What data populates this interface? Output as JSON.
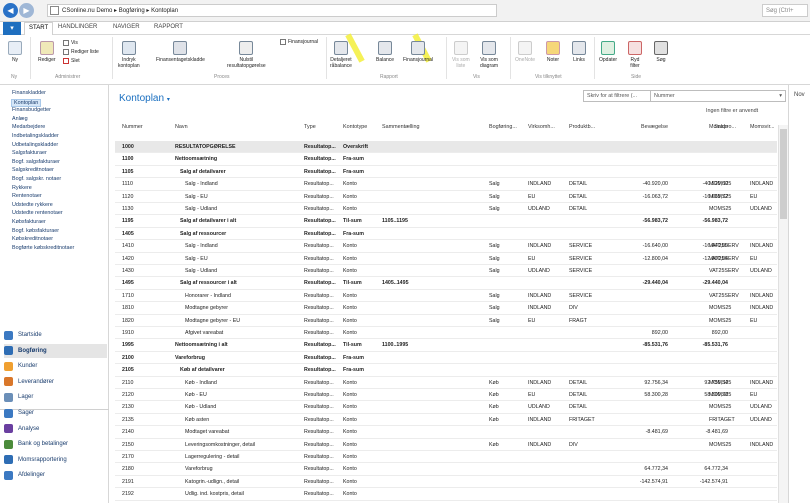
{
  "window": {
    "address": "CSonline.nu Demo  ▸  Bogføring  ▸  Kontoplan",
    "search_placeholder": "Søg (Ctrl+"
  },
  "tabs": [
    {
      "label": "START"
    },
    {
      "label": "HANDLINGER"
    },
    {
      "label": "NAVIGER"
    },
    {
      "label": "RAPPORT"
    }
  ],
  "ribbon": {
    "buttons": {
      "ny": "Ny",
      "rediger": "Rediger",
      "indryk": "Indryk\nkontoplan",
      "finanskladde": "Finansentagetskladde",
      "nulstil": "Nulstil\nresultatopgørelse",
      "detaljeret": "Detaljeret\nråbalance",
      "balance": "Balance",
      "finansjournal": "Finansjournal",
      "vis_som_liste": "Vis som\nliste",
      "vis_som_diagram": "Vis som\ndiagram",
      "onenote": "OneNote",
      "noter": "Noter",
      "links": "Links",
      "opdater": "Opdater",
      "ryd_filter": "Ryd\nfilter",
      "sog": "Søg"
    },
    "small": {
      "vis": "Vis",
      "rediger_liste": "Rediger liste",
      "slet": "Slet",
      "finansjournal2": "Finansjournal"
    },
    "groups": {
      "ny": "Ny",
      "administrer": "Administrer",
      "proces": "Proces",
      "rapport": "Rapport",
      "vis": "Vis",
      "vis_tilknyttet": "Vis tilknyttet",
      "side": "Side"
    }
  },
  "leftnav": {
    "links": [
      "Finanskladder",
      "Kontoplan",
      "Finansbudgetter",
      "Anlæg",
      "Medarbejdere",
      "Indbetalingskladder",
      "Udbetalingskladder",
      "Salgsfakturaer",
      "Bogf. salgsfakturaer",
      "Salgskreditnotaer",
      "Bogf. salgskr. notaer",
      "Rykkere",
      "Rentenotaer",
      "Udstedte rykkere",
      "Udstedte rentenotaer",
      "Købsfakturaer",
      "Bogf. købsfakturaer",
      "Købskreditnotaer",
      "Bogførte købskreditnotaer"
    ],
    "sections": [
      "Startside",
      "Bogføring",
      "Kunder",
      "Leverandører",
      "Lager",
      "Sager",
      "Analyse",
      "Bank og betalinger",
      "Momsrapportering",
      "Afdelinger"
    ]
  },
  "main": {
    "title": "Kontoplan",
    "filter_placeholder": "Skriv for at filtrere (...",
    "filter_field": "Nummer",
    "no_filter": "Ingen filtre er anvendt",
    "columns": [
      "Nummer",
      "Navn",
      "Type",
      "Kontotype",
      "Sammentælling",
      "Bogføring...",
      "Virksomh...",
      "Produktb...",
      "Bevægelse",
      "Saldo",
      "Momspro...",
      "Momsvir..."
    ],
    "rows": [
      [
        "1000",
        "RESULTATOPGØRELSE",
        "Resultatop...",
        "Overskrift",
        "",
        "",
        "",
        "",
        "",
        "",
        "",
        ""
      ],
      [
        "1100",
        "Nettoomsætning",
        "Resultatop...",
        "Fra-sum",
        "",
        "",
        "",
        "",
        "",
        "",
        "",
        ""
      ],
      [
        "1105",
        "Salg af detailvarer",
        "Resultatop...",
        "Fra-sum",
        "",
        "",
        "",
        "",
        "",
        "",
        "",
        ""
      ],
      [
        "1110",
        "Salg - Indland",
        "Resultatop...",
        "Konto",
        "",
        "Salg",
        "INDLAND",
        "DETAIL",
        "-40.920,00",
        "-40.920,00",
        "MOMS25",
        "INDLAND"
      ],
      [
        "1120",
        "Salg - EU",
        "Resultatop...",
        "Konto",
        "",
        "Salg",
        "EU",
        "DETAIL",
        "-16.063,72",
        "-16.063,72",
        "MOMS25",
        "EU"
      ],
      [
        "1130",
        "Salg - Udland",
        "Resultatop...",
        "Konto",
        "",
        "Salg",
        "UDLAND",
        "DETAIL",
        "",
        "",
        "MOMS25",
        "UDLAND"
      ],
      [
        "1195",
        "Salg af detailvarer i alt",
        "Resultatop...",
        "Til-sum",
        "1105..1195",
        "",
        "",
        "",
        "-56.983,72",
        "-56.983,72",
        "",
        ""
      ],
      [
        "1405",
        "Salg af ressourcer",
        "Resultatop...",
        "Fra-sum",
        "",
        "",
        "",
        "",
        "",
        "",
        "",
        ""
      ],
      [
        "1410",
        "Salg - Indland",
        "Resultatop...",
        "Konto",
        "",
        "Salg",
        "INDLAND",
        "SERVICE",
        "-16.640,00",
        "-16.640,00",
        "VAT25SERV",
        "INDLAND"
      ],
      [
        "1420",
        "Salg - EU",
        "Resultatop...",
        "Konto",
        "",
        "Salg",
        "EU",
        "SERVICE",
        "-12.800,04",
        "-12.800,04",
        "VAT25SERV",
        "EU"
      ],
      [
        "1430",
        "Salg - Udland",
        "Resultatop...",
        "Konto",
        "",
        "Salg",
        "UDLAND",
        "SERVICE",
        "",
        "",
        "VAT25SERV",
        "UDLAND"
      ],
      [
        "1495",
        "Salg af ressourcer i alt",
        "Resultatop...",
        "Til-sum",
        "1405..1495",
        "",
        "",
        "",
        "-29.440,04",
        "-29.440,04",
        "",
        ""
      ],
      [
        "1710",
        "Honorarer - Indland",
        "Resultatop...",
        "Konto",
        "",
        "Salg",
        "INDLAND",
        "SERVICE",
        "",
        "",
        "VAT25SERV",
        "INDLAND"
      ],
      [
        "1810",
        "Modtagne gebyrer",
        "Resultatop...",
        "Konto",
        "",
        "Salg",
        "INDLAND",
        "DIV",
        "",
        "",
        "MOMS25",
        "INDLAND"
      ],
      [
        "1820",
        "Modtagne gebyrer - EU",
        "Resultatop...",
        "Konto",
        "",
        "Salg",
        "EU",
        "FRAGT",
        "",
        "",
        "MOMS25",
        "EU"
      ],
      [
        "1910",
        "Afgivet vareabat",
        "Resultatop...",
        "Konto",
        "",
        "",
        "",
        "",
        "892,00",
        "892,00",
        "",
        ""
      ],
      [
        "1995",
        "Nettoomsætning i alt",
        "Resultatop...",
        "Til-sum",
        "1100..1995",
        "",
        "",
        "",
        "-85.531,76",
        "-85.531,76",
        "",
        ""
      ],
      [
        "2100",
        "Vareforbrug",
        "Resultatop...",
        "Fra-sum",
        "",
        "",
        "",
        "",
        "",
        "",
        "",
        ""
      ],
      [
        "2105",
        "Køb af detailvarer",
        "Resultatop...",
        "Fra-sum",
        "",
        "",
        "",
        "",
        "",
        "",
        "",
        ""
      ],
      [
        "2110",
        "Køb - Indland",
        "Resultatop...",
        "Konto",
        "",
        "Køb",
        "INDLAND",
        "DETAIL",
        "92.756,34",
        "92.756,34",
        "MOMS25",
        "INDLAND"
      ],
      [
        "2120",
        "Køb - EU",
        "Resultatop...",
        "Konto",
        "",
        "Køb",
        "EU",
        "DETAIL",
        "58.300,28",
        "58.300,28",
        "MOMS25",
        "EU"
      ],
      [
        "2130",
        "Køb - Udland",
        "Resultatop...",
        "Konto",
        "",
        "Køb",
        "UDLAND",
        "DETAIL",
        "",
        "",
        "MOMS25",
        "UDLAND"
      ],
      [
        "2135",
        "Køb asten",
        "Resultatop...",
        "Konto",
        "",
        "Køb",
        "INDLAND",
        "FRITAGET",
        "",
        "",
        "FRITAGET",
        "UDLAND"
      ],
      [
        "2140",
        "Modtaget vareabat",
        "Resultatop...",
        "Konto",
        "",
        "",
        "",
        "",
        "-8.481,69",
        "-8.481,69",
        "",
        ""
      ],
      [
        "2150",
        "Leveringsomkostninger, detail",
        "Resultatop...",
        "Konto",
        "",
        "Køb",
        "INDLAND",
        "DIV",
        "",
        "",
        "MOMS25",
        "INDLAND"
      ],
      [
        "2170",
        "Lagerregulering - detail",
        "Resultatop...",
        "Konto",
        "",
        "",
        "",
        "",
        "",
        "",
        "",
        ""
      ],
      [
        "2180",
        "Vareforbrug",
        "Resultatop...",
        "Konto",
        "",
        "",
        "",
        "",
        "64.772,34",
        "64.772,34",
        "",
        ""
      ],
      [
        "2191",
        "Katogrin.-udlign., detail",
        "Resultatop...",
        "Konto",
        "",
        "",
        "",
        "",
        "-142.574,91",
        "-142.574,91",
        "",
        ""
      ],
      [
        "2192",
        "Udlig. ind. kostpris, detail",
        "Resultatop...",
        "Konto",
        "",
        "",
        "",
        "",
        "",
        "",
        "",
        ""
      ]
    ],
    "bold_rows": [
      0,
      1,
      2,
      6,
      7,
      11,
      16,
      17,
      18
    ]
  },
  "factbox": {
    "label": "Nov"
  }
}
